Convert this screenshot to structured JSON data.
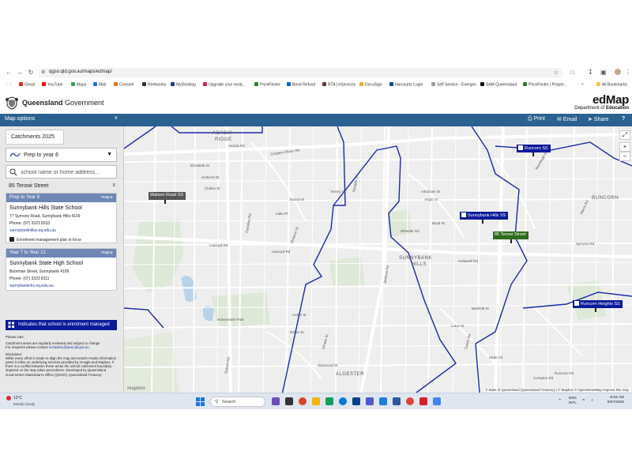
{
  "browser": {
    "url": "qgso.qld.gov.au/maps/edmap/",
    "bookmarks": [
      "Gmail",
      "YouTube",
      "Maps",
      "Mail",
      "Console",
      "Reelworks",
      "MyDesktop",
      "Upgrade your resid...",
      "PriceFinder",
      "Bond Refund",
      "RTA | eServices",
      "DocuSign",
      "Harcourts Login",
      "Self Service - Energex",
      "SAM Queensland",
      "PriceFinder | Proper..."
    ],
    "all_bookmarks": "All Bookmarks"
  },
  "header": {
    "gov_name_bold": "Queensland",
    "gov_name_rest": " Government",
    "app_title": "edMap",
    "dept_prefix": "Department of ",
    "dept_name": "Education"
  },
  "toolbar": {
    "panel_title": "Map options",
    "close": "x",
    "print": "Print",
    "email": "Email",
    "share": "Share",
    "help": "?"
  },
  "panel": {
    "catchments_tab": "Catchments 2025",
    "level_selected": "Prep to year 6",
    "search_placeholder": "school name or home address...",
    "address": "85 Terowi Street",
    "address_clear": "x",
    "cards": [
      {
        "level": "Prep to Year 6",
        "map_link": "map ▸",
        "name": "Sunnybank Hills State School",
        "address": "77 Symons Road, Sunnybank Hills 4109",
        "phone": "Phone:  (07) 3323 8333",
        "email": "sunnybankhillss.eq.edu.au",
        "note": "Enrolment management plan in force"
      },
      {
        "level": "Year 7 to Year 12",
        "map_link": "map ▸",
        "name": "Sunnybank State High School",
        "address": "Boorman Street, Sunnybank 4109",
        "phone": "Phone:  (07) 3323 8111",
        "email": "sunnybankshs.eq.edu.au",
        "note": ""
      }
    ],
    "legend_text": "Indicates that school is enrolment managed",
    "notes_title": "Please note:",
    "notes_line1": "Catchment areas are regularly reviewed and subject to change",
    "notes_line2_prefix": "For enquiries please contact ",
    "notes_line2_link": "schadeny@qed.qld.gov.au",
    "disclaimer_title": "Disclaimer:",
    "disclaimer_body": "While every effort is made to align the map and search results information panel it relies on underlying services provided by Google and Mapbox. If there is a conflict between these areas the school catchment boundary depicted on the map takes precedence. Developed by Queensland Government Statistician's Office (QGSO), Queensland Treasury"
  },
  "map": {
    "pins": [
      {
        "label": "Watson Road SS",
        "color": "#555555"
      },
      {
        "label": "Runcorn SS",
        "color": "#0a1a9a"
      },
      {
        "label": "Sunnybank Hills SS",
        "color": "#0a1a9a"
      },
      {
        "label": "85 Terowi Street",
        "color": "#2e6b1e"
      },
      {
        "label": "Runcorn Heights SS",
        "color": "#0a1a9a"
      }
    ],
    "suburbs": [
      "ACACIA",
      "RIDGE",
      "SUNNYBANK",
      "HILLS",
      "ALGESTER",
      "RUNCORN"
    ],
    "streets": [
      "Acacia Rd",
      "Coopers Plains Rd",
      "Elizabeth St",
      "Amherst St",
      "Chilton St",
      "Paradise Rd",
      "Learoyd Rd",
      "Dacca St",
      "Lake Pl",
      "Mclaren St",
      "Arden St",
      "Dakar St",
      "Dinwin St",
      "Stanwood St",
      "Gowan Rd",
      "Beenleigh Rd",
      "Hellawell Rd",
      "Symons Rd",
      "Compton Rd",
      "Lotus St",
      "Banfield St",
      "Calam Rd",
      "Helen St",
      "Mains Rd",
      "Wheeler Rd",
      "Nyngan St",
      "Kenny St",
      "Ashdown St",
      "Anglo St",
      "Boyd St",
      "Jackson Rd",
      "Honeyeater Park",
      "Runcorn Rd"
    ],
    "attribution": "© State of Queensland (Queensland Treasury) | © Mapbox © OpenStreetMap Improve this map",
    "mapbox": "mapbox",
    "zoom_in": "+",
    "zoom_out": "−",
    "fullscreen": "⤢"
  },
  "taskbar": {
    "temp": "12°C",
    "weather": "Mostly cloudy",
    "search": "Search",
    "lang_line1": "ENG",
    "lang_line2": "INTL",
    "time": "8:04 AM",
    "date": "9/07/2025"
  }
}
